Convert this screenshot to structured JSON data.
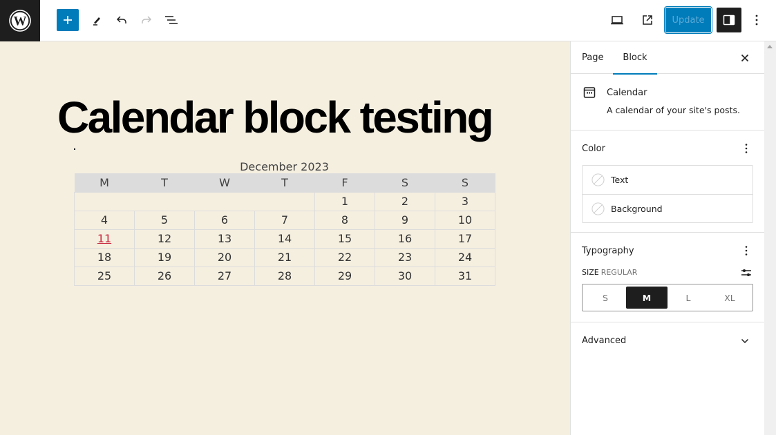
{
  "toolbar": {
    "logo_icon": "wordpress-logo-icon",
    "add_block_icon": "plus-icon",
    "tools_icon": "pencil-icon",
    "undo_icon": "undo-icon",
    "redo_icon": "redo-icon",
    "list_view_icon": "list-view-icon",
    "preview_icon": "laptop-icon",
    "view_post_icon": "external-link-icon",
    "update_label": "Update",
    "settings_icon": "sidebar-toggle-icon",
    "options_icon": "more-vertical-icon"
  },
  "canvas": {
    "page_title": "Calendar block testing",
    "calendar": {
      "caption": "December 2023",
      "weekdays": [
        "M",
        "T",
        "W",
        "T",
        "F",
        "S",
        "S"
      ],
      "weeks": [
        [
          "",
          "",
          "",
          "",
          "1",
          "2",
          "3"
        ],
        [
          "4",
          "5",
          "6",
          "7",
          "8",
          "9",
          "10"
        ],
        [
          "11",
          "12",
          "13",
          "14",
          "15",
          "16",
          "17"
        ],
        [
          "18",
          "19",
          "20",
          "21",
          "22",
          "23",
          "24"
        ],
        [
          "25",
          "26",
          "27",
          "28",
          "29",
          "30",
          "31"
        ]
      ],
      "linked_day": "11",
      "linked_color": "#c8273f"
    }
  },
  "sidebar": {
    "tabs": [
      {
        "label": "Page",
        "active": false
      },
      {
        "label": "Block",
        "active": true
      }
    ],
    "block": {
      "name": "Calendar",
      "description": "A calendar of your site's posts.",
      "icon": "calendar-icon"
    },
    "color": {
      "title": "Color",
      "items": [
        {
          "label": "Text"
        },
        {
          "label": "Background"
        }
      ]
    },
    "typography": {
      "title": "Typography",
      "size_label": "Size",
      "size_value": "Regular",
      "sizes": [
        "S",
        "M",
        "L",
        "XL"
      ],
      "selected_size": "M"
    },
    "advanced": {
      "title": "Advanced"
    }
  },
  "colors": {
    "accent": "#007cba",
    "dark": "#1e1e1e",
    "canvas_bg": "#f5efe0"
  }
}
